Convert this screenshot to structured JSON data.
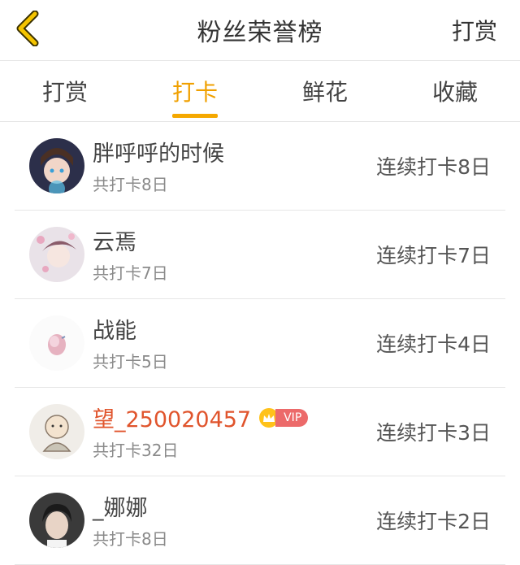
{
  "header": {
    "title": "粉丝荣誉榜",
    "action": "打赏"
  },
  "tabs": [
    {
      "label": "打赏",
      "active": false
    },
    {
      "label": "打卡",
      "active": true
    },
    {
      "label": "鲜花",
      "active": false
    },
    {
      "label": "收藏",
      "active": false
    }
  ],
  "fans": [
    {
      "name": "胖呼呼的时候",
      "total": "共打卡8日",
      "streak": "连续打卡8日",
      "vip": false
    },
    {
      "name": "云焉",
      "total": "共打卡7日",
      "streak": "连续打卡7日",
      "vip": false
    },
    {
      "name": "战能",
      "total": "共打卡5日",
      "streak": "连续打卡4日",
      "vip": false
    },
    {
      "name": "望_250020457",
      "total": "共打卡32日",
      "streak": "连续打卡3日",
      "vip": true,
      "vip_label": "VIP"
    },
    {
      "name": "_娜娜",
      "total": "共打卡8日",
      "streak": "连续打卡2日",
      "vip": false
    }
  ],
  "colors": {
    "accent": "#f5a800",
    "vip_name": "#e0542c",
    "vip_badge": "#ec6a6a"
  }
}
